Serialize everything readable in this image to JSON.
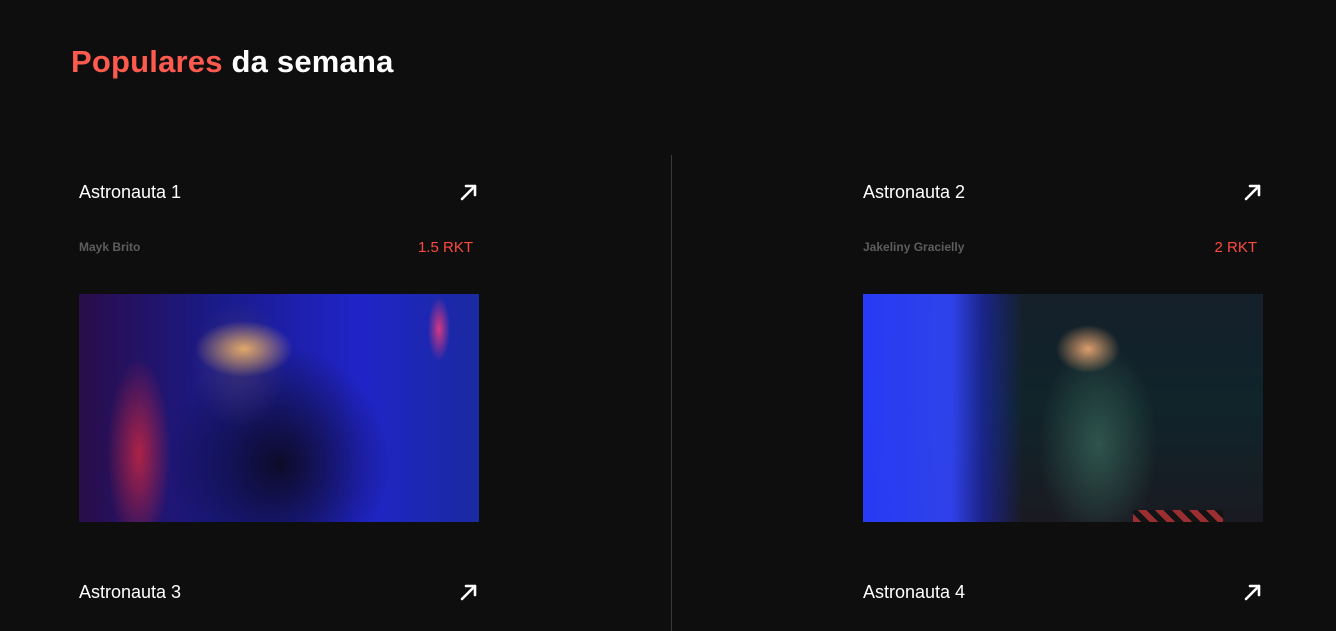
{
  "section": {
    "title_accent": "Populares",
    "title_rest": " da semana"
  },
  "cards": [
    {
      "title": "Astronauta 1",
      "author": "Mayk Brito",
      "price": "1.5 RKT",
      "image_alt": "Astronauta 1"
    },
    {
      "title": "Astronauta 2",
      "author": "Jakeliny Gracielly",
      "price": "2 RKT",
      "image_alt": "Astronauta 2"
    },
    {
      "title": "Astronauta 3"
    },
    {
      "title": "Astronauta 4"
    }
  ],
  "colors": {
    "background": "#0e0e0e",
    "accent": "#ff5a4e",
    "price": "#ff4a3d",
    "muted_text": "#5d5d5d",
    "divider": "#3a3a3a"
  },
  "icons": {
    "card_link": "arrow-up-right-icon"
  }
}
